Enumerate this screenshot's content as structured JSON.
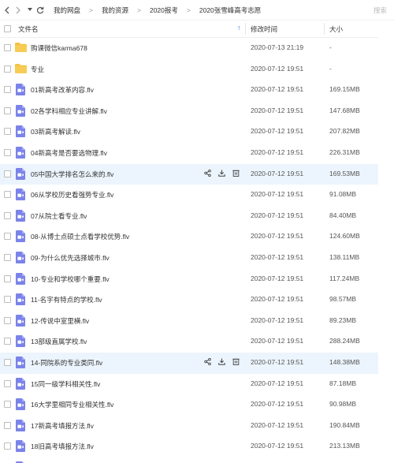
{
  "nav": {
    "breadcrumbs": [
      "我的网盘",
      "我的资源",
      "2020报考",
      "2020张雪峰高考志愿"
    ],
    "separator": ">",
    "search_placeholder": "搜索"
  },
  "table": {
    "columns": {
      "name": "文件名",
      "time": "修改时间",
      "size": "大小"
    },
    "sort": {
      "column": "name",
      "direction": "ascending"
    }
  },
  "files": [
    {
      "type": "folder",
      "name": "购课微信karma678",
      "time": "2020-07-13 21:19",
      "size": "-"
    },
    {
      "type": "folder",
      "name": "专业",
      "time": "2020-07-12 19:51",
      "size": "-"
    },
    {
      "type": "video",
      "name": "01新高考改革内容.flv",
      "time": "2020-07-12 19:51",
      "size": "169.15MB"
    },
    {
      "type": "video",
      "name": "02各学科相应专业讲解.flv",
      "time": "2020-07-12 19:51",
      "size": "147.68MB"
    },
    {
      "type": "video",
      "name": "03新高考解读.flv",
      "time": "2020-07-12 19:51",
      "size": "207.82MB"
    },
    {
      "type": "video",
      "name": "04新高考是否要选物理.flv",
      "time": "2020-07-12 19:51",
      "size": "226.31MB"
    },
    {
      "type": "video",
      "name": "05中国大学排名怎么来的.flv",
      "time": "2020-07-12 19:51",
      "size": "169.53MB",
      "hover": true
    },
    {
      "type": "video",
      "name": "06从学校历史看强势专业.flv",
      "time": "2020-07-12 19:51",
      "size": "91.08MB"
    },
    {
      "type": "video",
      "name": "07从院士看专业.flv",
      "time": "2020-07-12 19:51",
      "size": "84.40MB"
    },
    {
      "type": "video",
      "name": "08-从博士点硕士点看学校优势.flv",
      "time": "2020-07-12 19:51",
      "size": "124.60MB"
    },
    {
      "type": "video",
      "name": "09-为什么优先选择城市.flv",
      "time": "2020-07-12 19:51",
      "size": "138.11MB"
    },
    {
      "type": "video",
      "name": "10-专业和学校哪个重要.flv",
      "time": "2020-07-12 19:51",
      "size": "117.24MB"
    },
    {
      "type": "video",
      "name": "11-名字有特点的学校.flv",
      "time": "2020-07-12 19:51",
      "size": "98.57MB"
    },
    {
      "type": "video",
      "name": "12-传说中室里横.flv",
      "time": "2020-07-12 19:51",
      "size": "89.23MB"
    },
    {
      "type": "video",
      "name": "13部级直属学校.flv",
      "time": "2020-07-12 19:51",
      "size": "288.24MB"
    },
    {
      "type": "video",
      "name": "14-同院系的专业类同.flv",
      "time": "2020-07-12 19:51",
      "size": "148.38MB",
      "hover": true
    },
    {
      "type": "video",
      "name": "15同一级学科相关性.flv",
      "time": "2020-07-12 19:51",
      "size": "87.18MB"
    },
    {
      "type": "video",
      "name": "16大学里相同专业相关性.flv",
      "time": "2020-07-12 19:51",
      "size": "90.98MB"
    },
    {
      "type": "video",
      "name": "17新高考填报方法.flv",
      "time": "2020-07-12 19:51",
      "size": "190.84MB"
    },
    {
      "type": "video",
      "name": "18旧高考填报方法.flv",
      "time": "2020-07-12 19:51",
      "size": "213.13MB"
    },
    {
      "type": "video",
      "name": "",
      "time": "",
      "size": ""
    }
  ],
  "row_actions": [
    "share-icon",
    "download-icon",
    "delete-icon"
  ],
  "colors": {
    "folder": "#f5c342",
    "video_icon": "#7b83ea",
    "hover_row": "#ecf5fd",
    "accent": "#2b7de0"
  }
}
